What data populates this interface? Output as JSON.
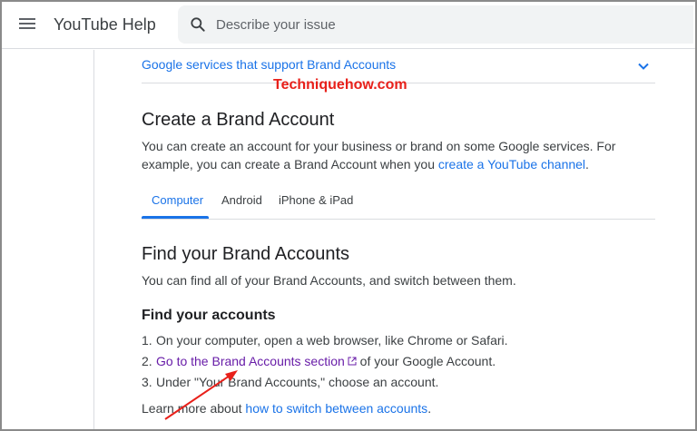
{
  "header": {
    "app_title": "YouTube Help",
    "search_placeholder": "Describe your issue"
  },
  "expander": {
    "label": "Google services that support Brand Accounts"
  },
  "watermark": "Techniquehow.com",
  "create_section": {
    "title": "Create a Brand Account",
    "body_prefix": "You can create an account for your business or brand on some Google services. For example, you can create a Brand Account when you ",
    "link": "create a YouTube channel",
    "body_suffix": "."
  },
  "tabs": [
    {
      "label": "Computer",
      "active": true
    },
    {
      "label": "Android",
      "active": false
    },
    {
      "label": "iPhone & iPad",
      "active": false
    }
  ],
  "find_section": {
    "title": "Find your Brand Accounts",
    "body": "You can find all of your Brand Accounts, and switch between them."
  },
  "find_accounts": {
    "title": "Find your accounts",
    "steps": [
      {
        "num": "1.",
        "text": "On your computer, open a web browser, like Chrome or Safari."
      },
      {
        "num": "2.",
        "link": "Go to the Brand Accounts section",
        "text": " of your Google Account."
      },
      {
        "num": "3.",
        "text": "Under \"Your Brand Accounts,\" choose an account."
      }
    ],
    "learn_prefix": "Learn more about ",
    "learn_link": "how to switch between accounts",
    "learn_suffix": "."
  },
  "colors": {
    "link": "#1a73e8",
    "visited_link": "#681da8",
    "annotation": "#e8201a"
  },
  "icons": [
    "hamburger-menu-icon",
    "search-icon",
    "chevron-down-icon",
    "external-link-icon",
    "annotation-arrow"
  ]
}
